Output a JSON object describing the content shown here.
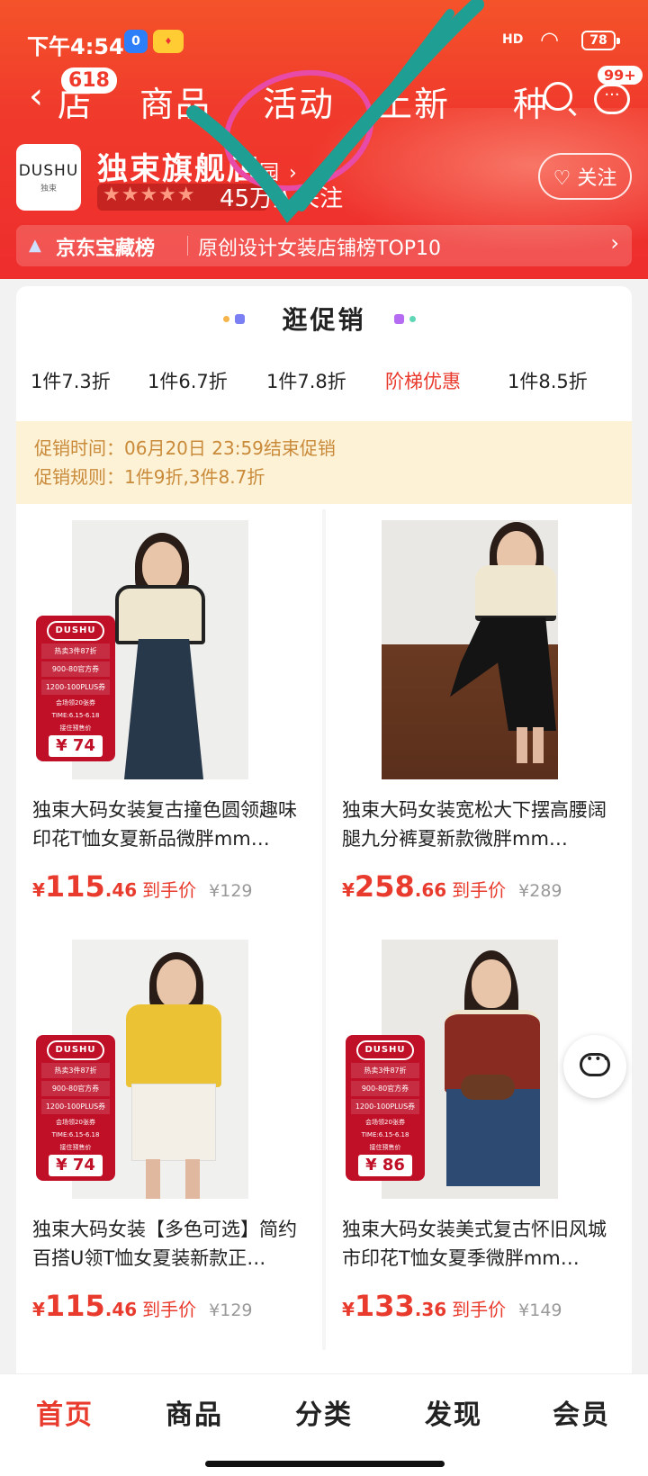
{
  "status": {
    "time": "下午4:54",
    "network": "HD",
    "battery": "78"
  },
  "nav": {
    "back_label": "‹",
    "badge": "618",
    "tabs": [
      "店",
      "商品",
      "活动",
      "上新",
      "种"
    ],
    "more_badge": "99+"
  },
  "shop": {
    "logo_text": "DUSHU",
    "logo_sub": "独束",
    "name": "独束旗舰店",
    "name_suffix": "园 ›",
    "stars": "★★★★★",
    "followers": "45万人关注",
    "follow_label": "♡ 关注"
  },
  "rank": {
    "title": "京东宝藏榜",
    "text": "原创设计女装店铺榜TOP10",
    "chevron": "›"
  },
  "promo": {
    "title": "逛促销",
    "discounts": [
      "1件7.3折",
      "1件6.7折",
      "1件7.8折",
      "阶梯优惠",
      "1件8.5折"
    ],
    "active_index": 3,
    "time_text": "促销时间：06月20日 23:59结束促销",
    "rule_text": "促销规则：1件9折,3件8.7折"
  },
  "tag": {
    "logo": "DUSHU",
    "line1": "热卖3件87折",
    "line2": "900-80官方券",
    "line3": "1200-100PLUS券",
    "small1": "会场领20张券",
    "small2": "TIME:6.15-6.18",
    "small3": "接住预售价"
  },
  "products": [
    {
      "title": "独束大码女装复古撞色圆领趣味印花T恤女夏新品微胖mm…",
      "yen": "¥",
      "price_int": "115",
      "price_dec": ".46",
      "price_label": "到手价",
      "orig": "¥129",
      "tag_price": "¥ 74",
      "has_tag": true
    },
    {
      "title": "独束大码女装宽松大下摆高腰阔腿九分裤夏新款微胖mm…",
      "yen": "¥",
      "price_int": "258",
      "price_dec": ".66",
      "price_label": "到手价",
      "orig": "¥289",
      "tag_price": "",
      "has_tag": false
    },
    {
      "title": "独束大码女装【多色可选】简约百搭U领T恤女夏装新款正…",
      "yen": "¥",
      "price_int": "115",
      "price_dec": ".46",
      "price_label": "到手价",
      "orig": "¥129",
      "tag_price": "¥ 74",
      "has_tag": true
    },
    {
      "title": "独束大码女装美式复古怀旧风城市印花T恤女夏季微胖mm…",
      "yen": "¥",
      "price_int": "133",
      "price_dec": ".36",
      "price_label": "到手价",
      "orig": "¥149",
      "tag_price": "¥ 86",
      "has_tag": true
    }
  ],
  "bottom_nav": [
    "首页",
    "商品",
    "分类",
    "发现",
    "会员"
  ],
  "colors": {
    "accent": "#e93b2d",
    "header": "#f03a2c",
    "info_bg": "#fdf2d6",
    "info_text": "#c98a3a",
    "tag_red": "#c01028"
  }
}
